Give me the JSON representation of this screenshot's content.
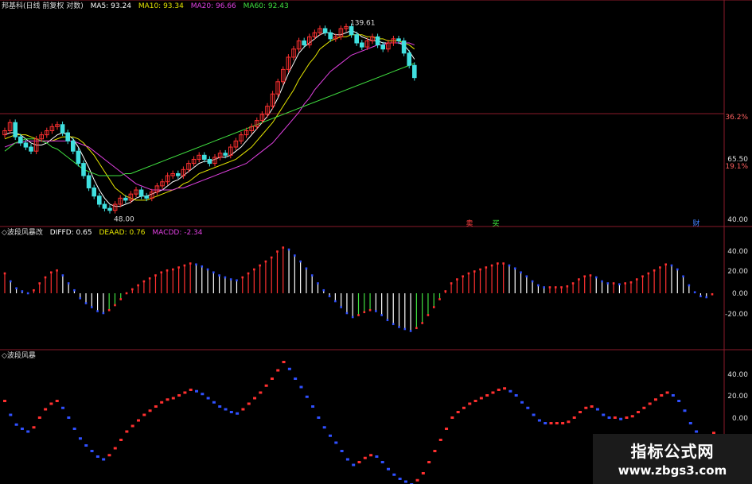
{
  "header": {
    "title": "邦基科(日线 前复权 对数)",
    "ma": [
      {
        "label": "MA5: 93.24",
        "color": "#ffffff"
      },
      {
        "label": "MA10: 93.34",
        "color": "#e6e600"
      },
      {
        "label": "MA20: 96.66",
        "color": "#e040e0"
      },
      {
        "label": "MA60: 92.43",
        "color": "#40e040"
      }
    ]
  },
  "price_axis": [
    "36.2%",
    "65.50",
    "19.1%",
    "40.00"
  ],
  "price_annotations": {
    "high": "139.61",
    "low": "48.00"
  },
  "markers": [
    {
      "label": "卖",
      "color": "#ff4040"
    },
    {
      "label": "买",
      "color": "#40ff40"
    },
    {
      "label": "财",
      "color": "#4080ff"
    }
  ],
  "macd_panel": {
    "title": "◇波段风暴改",
    "stats": [
      {
        "label": "DIFFD: 0.65",
        "color": "#ffffff"
      },
      {
        "label": "DEAAD: 0.76",
        "color": "#e6e600"
      },
      {
        "label": "MACDD: -2.34",
        "color": "#e040e0"
      }
    ],
    "ticks": [
      "40.00",
      "20.00",
      "0.00",
      "-20.00"
    ]
  },
  "storm_panel": {
    "title": "◇波段风暴",
    "ticks": [
      "40.00",
      "20.00",
      "0.00",
      "-20.00"
    ]
  },
  "watermark": {
    "line1": "指标公式网",
    "line2": "www.zbgs3.com"
  },
  "chart_data": {
    "type": "candlestick",
    "panels": [
      "price",
      "macd",
      "storm"
    ],
    "close_series": [
      88,
      92,
      85,
      82,
      80,
      78,
      84,
      86,
      88,
      90,
      91,
      87,
      83,
      78,
      72,
      66,
      60,
      56,
      52,
      50,
      49,
      52,
      55,
      54,
      57,
      59,
      56,
      55,
      58,
      61,
      63,
      66,
      67,
      66,
      69,
      72,
      74,
      76,
      74,
      72,
      75,
      77,
      76,
      80,
      83,
      86,
      88,
      90,
      93,
      96,
      100,
      106,
      112,
      118,
      124,
      128,
      132,
      130,
      134,
      136,
      138,
      136,
      133,
      134,
      138,
      139,
      135,
      131,
      129,
      132,
      134,
      130,
      128,
      131,
      133,
      132,
      126,
      120,
      114
    ],
    "ma_series": {
      "MA5": [
        86,
        87,
        87,
        86,
        84,
        82,
        81,
        81,
        82,
        84,
        86,
        87,
        86,
        84,
        80,
        75,
        70,
        64,
        59,
        55,
        52,
        51,
        51,
        52,
        53,
        55,
        56,
        56,
        57,
        58,
        59,
        61,
        63,
        64,
        66,
        68,
        70,
        72,
        73,
        73,
        74,
        75,
        75,
        76,
        78,
        80,
        83,
        86,
        89,
        92,
        95,
        99,
        104,
        110,
        116,
        121,
        126,
        129,
        131,
        133,
        135,
        136,
        136,
        135,
        135,
        136,
        137,
        136,
        134,
        133,
        132,
        132,
        131,
        131,
        131,
        131,
        130,
        127,
        123
      ],
      "MA10": [
        84,
        85,
        86,
        86,
        86,
        85,
        84,
        83,
        83,
        83,
        84,
        85,
        85,
        85,
        84,
        82,
        79,
        76,
        72,
        68,
        64,
        60,
        58,
        56,
        55,
        54,
        54,
        54,
        55,
        56,
        57,
        58,
        59,
        60,
        62,
        63,
        65,
        67,
        68,
        69,
        70,
        71,
        72,
        73,
        74,
        76,
        78,
        80,
        83,
        86,
        89,
        92,
        96,
        100,
        104,
        108,
        113,
        117,
        121,
        124,
        128,
        130,
        132,
        133,
        134,
        134,
        135,
        135,
        135,
        134,
        134,
        133,
        133,
        132,
        132,
        132,
        131,
        130,
        128
      ],
      "MA20": [
        80,
        81,
        82,
        82,
        83,
        83,
        83,
        83,
        83,
        83,
        83,
        83,
        83,
        83,
        82,
        81,
        80,
        78,
        76,
        74,
        72,
        70,
        68,
        66,
        64,
        62,
        61,
        60,
        59,
        59,
        59,
        59,
        59,
        60,
        60,
        61,
        62,
        63,
        64,
        65,
        66,
        67,
        68,
        69,
        70,
        71,
        72,
        74,
        76,
        78,
        80,
        82,
        85,
        88,
        91,
        94,
        97,
        101,
        104,
        108,
        111,
        114,
        117,
        119,
        121,
        123,
        125,
        126,
        127,
        128,
        129,
        130,
        130,
        131,
        131,
        131,
        131,
        131,
        130
      ],
      "MA60": [
        78,
        80,
        82,
        83,
        84,
        84,
        84,
        83,
        82,
        80,
        79,
        77,
        75,
        73,
        71,
        69,
        68,
        67,
        66,
        66,
        66,
        66,
        66,
        67,
        67,
        68,
        69,
        70,
        71,
        72,
        73,
        74,
        75,
        76,
        77,
        78,
        79,
        80,
        81,
        82,
        83,
        84,
        85,
        86,
        87,
        88,
        89,
        90,
        91,
        92,
        93,
        94,
        95,
        96,
        97,
        98,
        99,
        100,
        101,
        102,
        103,
        104,
        105,
        106,
        107,
        108,
        109,
        110,
        111,
        112,
        113,
        114,
        115,
        116,
        117,
        118,
        119,
        120,
        121
      ]
    },
    "macd_series": [
      20,
      12,
      5,
      2,
      0,
      3,
      10,
      16,
      21,
      23,
      18,
      10,
      3,
      -5,
      -10,
      -14,
      -18,
      -20,
      -17,
      -12,
      -6,
      0,
      4,
      8,
      12,
      15,
      18,
      21,
      23,
      24,
      26,
      28,
      30,
      29,
      27,
      24,
      21,
      18,
      16,
      14,
      13,
      16,
      20,
      24,
      28,
      32,
      36,
      42,
      46,
      44,
      38,
      32,
      25,
      18,
      10,
      3,
      -3,
      -8,
      -14,
      -20,
      -24,
      -22,
      -19,
      -17,
      -18,
      -22,
      -27,
      -31,
      -34,
      -36,
      -38,
      -35,
      -30,
      -22,
      -14,
      -6,
      2,
      10,
      14,
      17,
      20,
      22,
      24,
      26,
      28,
      30,
      30,
      28,
      25,
      21,
      17,
      12,
      8,
      6,
      6,
      6,
      6,
      7,
      10,
      14,
      17,
      18,
      16,
      12,
      10,
      10,
      9,
      10,
      11,
      14,
      17,
      20,
      23,
      26,
      29,
      28,
      24,
      17,
      8,
      1,
      -3,
      -4,
      -1
    ],
    "storm_series": [
      22,
      12,
      5,
      2,
      0,
      3,
      10,
      16,
      20,
      22,
      17,
      10,
      2,
      -5,
      -10,
      -14,
      -18,
      -20,
      -17,
      -12,
      -6,
      0,
      4,
      8,
      12,
      15,
      18,
      21,
      23,
      24,
      26,
      28,
      30,
      29,
      27,
      24,
      21,
      18,
      16,
      14,
      13,
      16,
      20,
      24,
      28,
      33,
      38,
      44,
      50,
      45,
      38,
      32,
      25,
      18,
      10,
      3,
      -3,
      -8,
      -14,
      -20,
      -24,
      -22,
      -19,
      -17,
      -18,
      -22,
      -27,
      -31,
      -34,
      -36,
      -38,
      -35,
      -30,
      -22,
      -14,
      -6,
      2,
      10,
      14,
      17,
      20,
      22,
      24,
      26,
      28,
      30,
      31,
      29,
      26,
      21,
      17,
      12,
      8,
      6,
      6,
      6,
      6,
      7,
      10,
      14,
      17,
      18,
      16,
      12,
      10,
      10,
      9,
      10,
      11,
      14,
      17,
      20,
      23,
      26,
      28,
      26,
      22,
      15,
      6,
      0,
      -4,
      -4,
      -1
    ],
    "macd_ylim": [
      -30,
      50
    ]
  }
}
